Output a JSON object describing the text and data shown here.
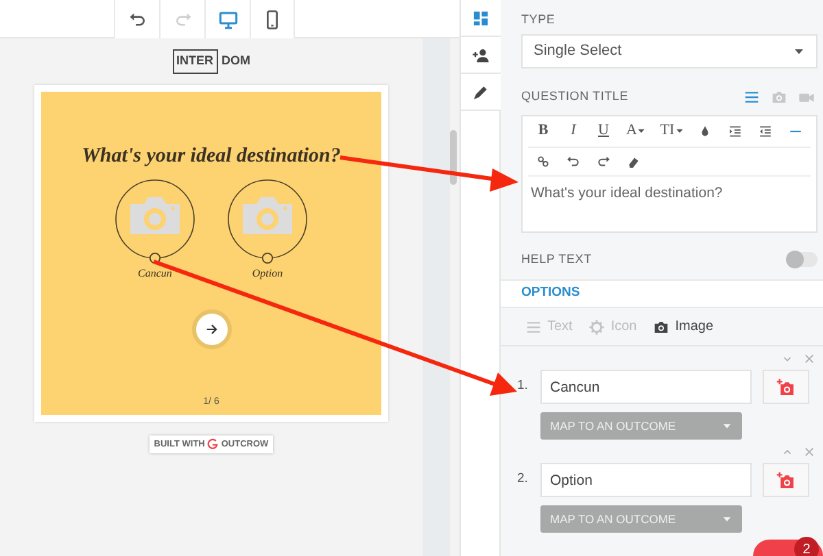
{
  "toolbar": [
    {
      "kind": "undo",
      "disabled": false,
      "selected": false
    },
    {
      "kind": "redo",
      "disabled": true,
      "selected": false
    },
    {
      "kind": "desktop",
      "disabled": false,
      "selected": true
    },
    {
      "kind": "mobile",
      "disabled": false,
      "selected": false
    }
  ],
  "preview": {
    "logo": [
      "INTER",
      "DOM"
    ],
    "title": "What's your ideal destination?",
    "options": [
      {
        "label": "Cancun"
      },
      {
        "label": "Option"
      }
    ],
    "page": "1/ 6",
    "built_with": [
      "BUILT WITH",
      "OUTCROW"
    ]
  },
  "sidebar": [
    {
      "kind": "layout",
      "selected": true
    },
    {
      "kind": "user-add",
      "selected": false
    },
    {
      "kind": "pencil",
      "selected": false
    }
  ],
  "type": {
    "label": "TYPE",
    "value": "Single Select"
  },
  "question_title": {
    "label": "QUESTION TITLE",
    "modes": [
      {
        "kind": "lines",
        "selected": true
      },
      {
        "kind": "camera",
        "selected": false
      },
      {
        "kind": "video",
        "selected": false
      }
    ],
    "tools": [
      [
        {
          "kind": "text",
          "label": "B",
          "selected": false
        },
        {
          "kind": "text",
          "label": "I",
          "selected": false
        },
        {
          "kind": "text",
          "label": "U",
          "selected": false
        },
        {
          "kind": "dropdown",
          "label": "A",
          "selected": false
        },
        {
          "kind": "dropdown",
          "label": "TI",
          "selected": false
        },
        {
          "kind": "drop",
          "selected": false
        },
        {
          "kind": "indent",
          "selected": false
        },
        {
          "kind": "outdent",
          "selected": false
        },
        {
          "kind": "rule",
          "selected": true
        }
      ],
      [
        {
          "kind": "link",
          "selected": false
        },
        {
          "kind": "undo",
          "selected": false
        },
        {
          "kind": "redo",
          "selected": false
        },
        {
          "kind": "eraser",
          "selected": false
        }
      ]
    ],
    "value": "What's your ideal destination?"
  },
  "help_text": {
    "label": "HELP TEXT",
    "on": false
  },
  "options": {
    "label": "OPTIONS",
    "tabs": [
      {
        "kind": "lines",
        "label": "Text",
        "selected": false
      },
      {
        "kind": "gear",
        "label": "Icon",
        "selected": false
      },
      {
        "kind": "camera",
        "label": "Image",
        "selected": true
      }
    ],
    "items": [
      {
        "number": "1.",
        "value": "Cancun",
        "kind": "move-down",
        "outcome": "MAP TO AN OUTCOME"
      },
      {
        "number": "2.",
        "value": "Option",
        "kind": "move-up",
        "outcome": "MAP TO AN OUTCOME"
      }
    ]
  },
  "chat": {
    "badge": "2"
  }
}
